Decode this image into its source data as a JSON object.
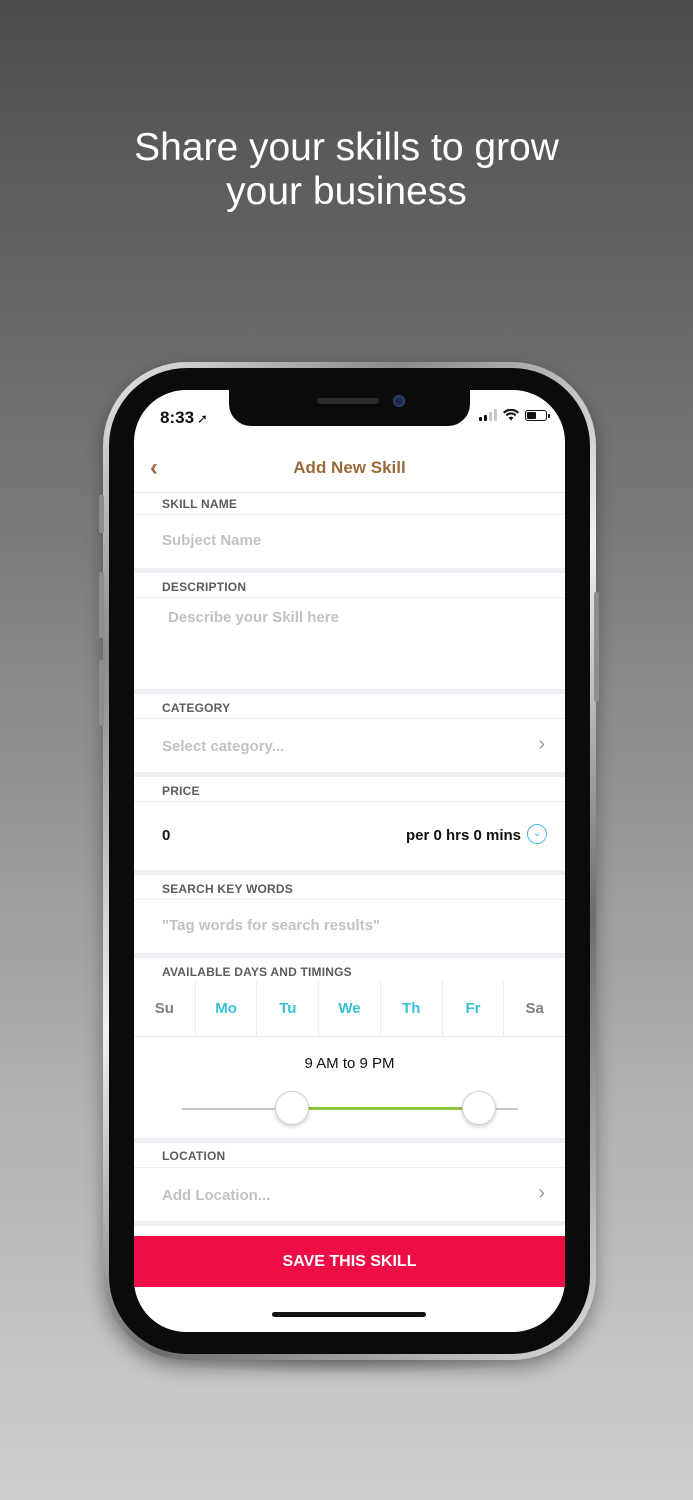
{
  "headline": {
    "line1": "Share your skills to grow",
    "line2": "your business"
  },
  "status_bar": {
    "time": "8:33",
    "location_glyph": "➚"
  },
  "nav": {
    "back_glyph": "‹",
    "title": "Add New Skill"
  },
  "skill_name": {
    "label": "SKILL NAME",
    "placeholder": "Subject Name"
  },
  "description": {
    "label": "DESCRIPTION",
    "placeholder": "Describe your Skill here"
  },
  "category": {
    "label": "CATEGORY",
    "placeholder": "Select category...",
    "chevron": "›"
  },
  "price": {
    "label": "PRICE",
    "value": "0",
    "per": "per 0 hrs 0 mins",
    "dropdown_glyph": "⌄"
  },
  "search": {
    "label": "SEARCH KEY WORDS",
    "placeholder": "\"Tag words for search results\""
  },
  "availability": {
    "label": "AVAILABLE DAYS AND TIMINGS",
    "days": [
      {
        "label": "Su",
        "active": false
      },
      {
        "label": "Mo",
        "active": true
      },
      {
        "label": "Tu",
        "active": true
      },
      {
        "label": "We",
        "active": true
      },
      {
        "label": "Th",
        "active": true
      },
      {
        "label": "Fr",
        "active": true
      },
      {
        "label": "Sa",
        "active": false
      }
    ],
    "time_range": "9 AM to 9 PM",
    "active_color": "#35c1d6",
    "range_color": "#8fc43f"
  },
  "location": {
    "label": "LOCATION",
    "placeholder": "Add Location...",
    "chevron": "›"
  },
  "save_button": {
    "label": "SAVE THIS SKILL",
    "color": "#ef0d47"
  },
  "accent_color": "#9a6a3a"
}
